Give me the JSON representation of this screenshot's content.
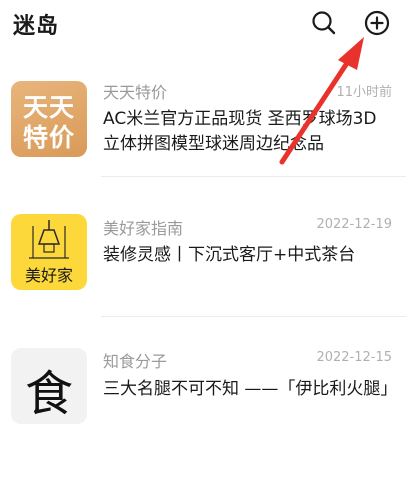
{
  "header": {
    "title": "迷岛",
    "search_icon": "search-icon",
    "add_icon": "plus-circle-icon"
  },
  "conversations": [
    {
      "name": "天天特价",
      "time": "11小时前",
      "message": "AC米兰官方正品现货 圣西罗球场3D立体拼图模型球迷周边纪念品",
      "avatar": {
        "line1": "天天",
        "line2": "特价"
      }
    },
    {
      "name": "美好家指南",
      "time": "2022-12-19",
      "message": "装修灵感丨下沉式客厅+中式茶台",
      "avatar": {
        "label": "美好家"
      }
    },
    {
      "name": "知食分子",
      "time": "2022-12-15",
      "message": "三大名腿不可不知 ——「伊比利火腿」",
      "avatar": {
        "label": "食"
      }
    }
  ],
  "colors": {
    "annotation_arrow": "#e8322b",
    "avatar1": "#dfa565",
    "avatar2": "#fcd83a"
  }
}
